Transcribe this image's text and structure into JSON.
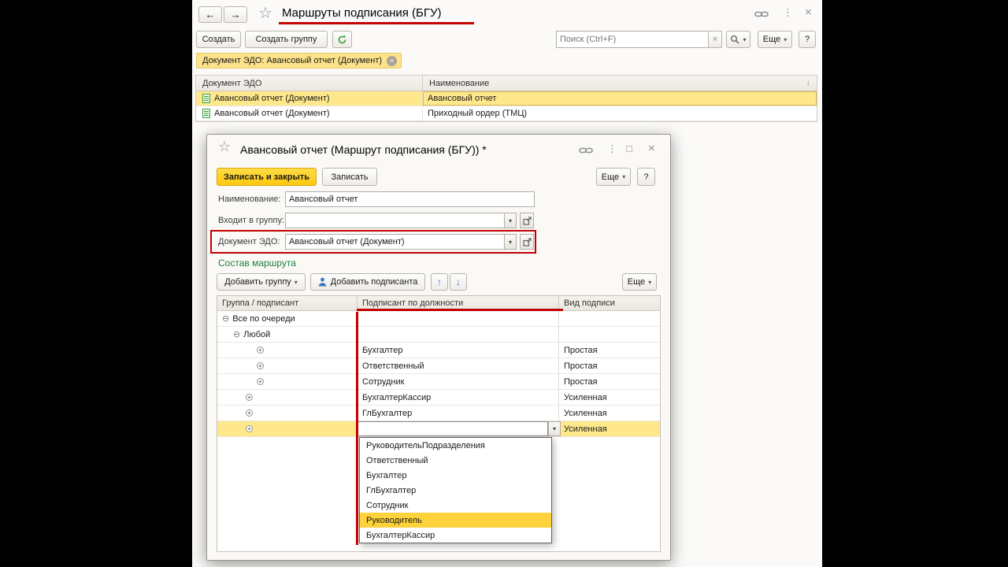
{
  "icons": {
    "back": "←",
    "forward": "→",
    "star": "☆",
    "dots": "⋮",
    "close": "×",
    "maximize": "□",
    "dropdown": "▾",
    "sort": "↓",
    "clear": "×",
    "chip_remove": "×",
    "expander": "⊖",
    "up": "↑",
    "down": "↓"
  },
  "main": {
    "title": "Маршруты подписания (БГУ)",
    "toolbar": {
      "create": "Создать",
      "create_group": "Создать группу",
      "search_placeholder": "Поиск (Ctrl+F)",
      "more": "Еще",
      "help": "?"
    },
    "filter_chip": {
      "label": "Документ ЭДО: Авансовый отчет (Документ)"
    },
    "table": {
      "col_doc": "Документ ЭДО",
      "col_name": "Наименование",
      "rows": [
        {
          "doc": "Авансовый отчет (Документ)",
          "name": "Авансовый отчет"
        },
        {
          "doc": "Авансовый отчет (Документ)",
          "name": "Приходный ордер (ТМЦ)"
        }
      ]
    }
  },
  "dialog": {
    "title": "Авансовый отчет (Маршрут подписания (БГУ)) *",
    "buttons": {
      "save_close": "Записать и закрыть",
      "save": "Записать",
      "more": "Еще",
      "help": "?"
    },
    "fields": {
      "name_label": "Наименование:",
      "name_value": "Авансовый отчет",
      "group_label": "Входит в группу:",
      "group_value": "",
      "doc_label": "Документ ЭДО:",
      "doc_value": "Авансовый отчет (Документ)"
    },
    "section": "Состав маршрута",
    "route_toolbar": {
      "add_group": "Добавить группу",
      "add_signer": "Добавить подписанта",
      "more": "Еще"
    },
    "route_table": {
      "col_group": "Группа / подписант",
      "col_position": "Подписант по должности",
      "col_sign": "Вид подписи",
      "rows": [
        {
          "label": "Все по очереди"
        },
        {
          "label": "Любой"
        },
        {
          "position": "Бухгалтер",
          "sign": "Простая"
        },
        {
          "position": "Ответственный",
          "sign": "Простая"
        },
        {
          "position": "Сотрудник",
          "sign": "Простая"
        },
        {
          "position": "БухгалтерКассир",
          "sign": "Усиленная"
        },
        {
          "position": "ГлБухгалтер",
          "sign": "Усиленная"
        },
        {
          "position": "",
          "sign": "Усиленная"
        }
      ]
    },
    "dropdown": {
      "items": [
        "РуководительПодразделения",
        "Ответственный",
        "Бухгалтер",
        "ГлБухгалтер",
        "Сотрудник",
        "Руководитель",
        "БухгалтерКассир"
      ],
      "highlighted": "Руководитель"
    }
  },
  "colors": {
    "selection_yellow": "#ffe88c",
    "primary_button_yellow": "#ffd21f",
    "annotation_red": "#c40000",
    "section_green": "#1d8040",
    "dropdown_highlight": "#fdd23a"
  }
}
